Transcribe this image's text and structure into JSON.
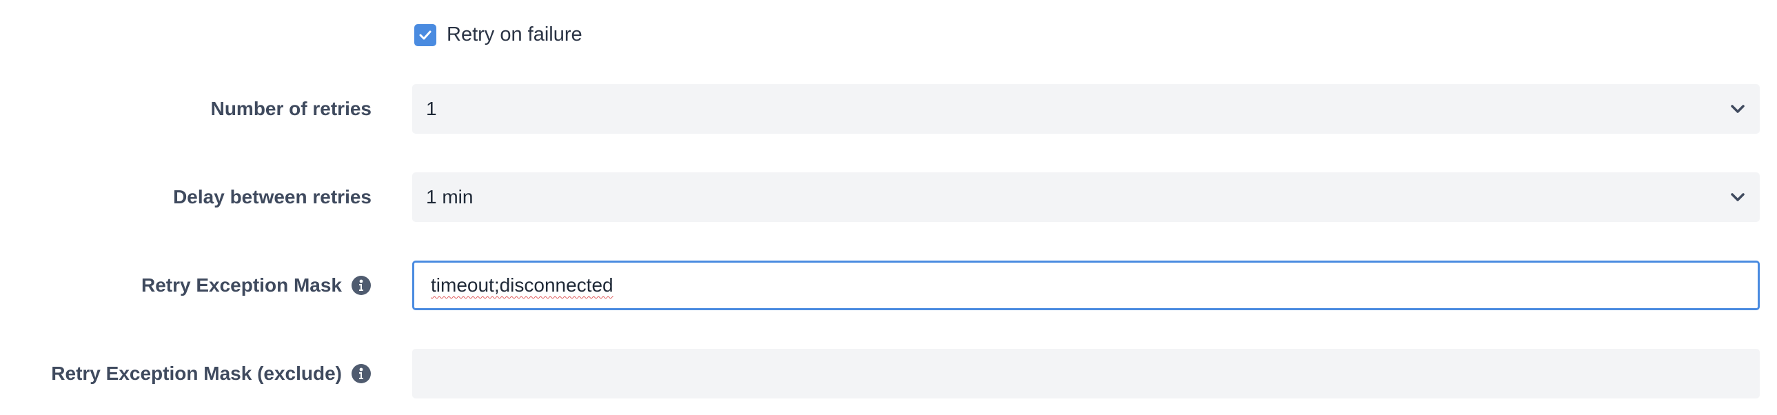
{
  "retry": {
    "checkbox_label": "Retry on failure",
    "checked": true
  },
  "number_of_retries": {
    "label": "Number of retries",
    "value": "1",
    "icon": "chevron-down-icon"
  },
  "delay_between_retries": {
    "label": "Delay between retries",
    "value": "1 min",
    "icon": "chevron-down-icon"
  },
  "retry_exception_mask": {
    "label": "Retry Exception Mask",
    "value": "timeout;disconnected",
    "icon": "info-icon"
  },
  "retry_exception_mask_exclude": {
    "label": "Retry Exception Mask (exclude)",
    "value": "",
    "icon": "info-icon"
  },
  "colors": {
    "accent": "#4a8be0",
    "field_bg": "#f3f4f6",
    "label_text": "#3f4a5e"
  }
}
